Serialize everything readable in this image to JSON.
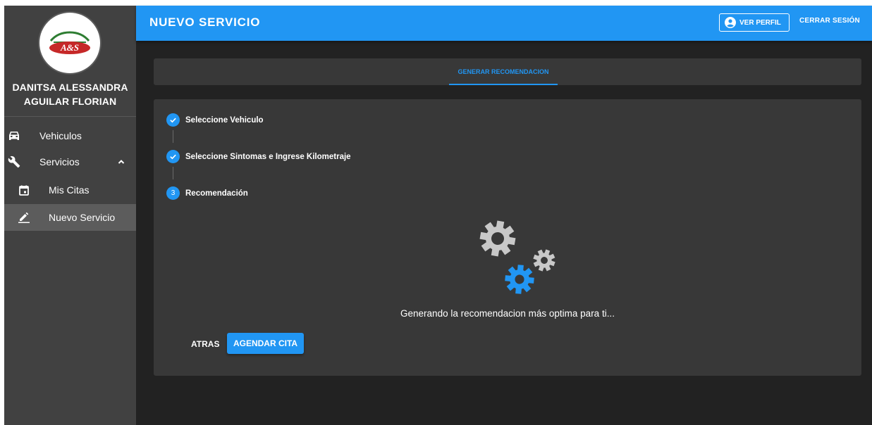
{
  "app": {
    "logo_text": "A&S",
    "user_name_line1": "DANITSA ALESSANDRA",
    "user_name_line2": "AGUILAR FLORIAN"
  },
  "sidebar": {
    "items": [
      {
        "label": "Vehiculos",
        "icon": "car-icon"
      },
      {
        "label": "Servicios",
        "icon": "wrench-icon",
        "expanded": true
      },
      {
        "label": "Mis Citas",
        "icon": "calendar-icon"
      },
      {
        "label": "Nuevo Servicio",
        "icon": "edit-icon",
        "active": true
      }
    ]
  },
  "header": {
    "title": "NUEVO SERVICIO",
    "profile_label": "VER PERFIL",
    "logout_label": "CERRAR SESIÓN"
  },
  "tabs": {
    "items": [
      {
        "label": "GENERAR RECOMENDACION",
        "active": true
      }
    ]
  },
  "stepper": {
    "steps": [
      {
        "label": "Seleccione Vehiculo",
        "state": "done"
      },
      {
        "label": "Seleccione Sintomas e Ingrese Kilometraje",
        "state": "done"
      },
      {
        "label": "Recomendación",
        "state": "current",
        "number": "3"
      }
    ],
    "loading_text": "Generando la recomendacion más optima para ti...",
    "back_label": "ATRAS",
    "schedule_label": "AGENDAR CITA"
  },
  "colors": {
    "primary": "#2196f3",
    "sidebar_bg": "#414141",
    "content_bg": "#222222",
    "card_bg": "#383838",
    "gear_gray": "#c8c8c8",
    "logo_red": "#c62828",
    "logo_green": "#2e7d32"
  }
}
